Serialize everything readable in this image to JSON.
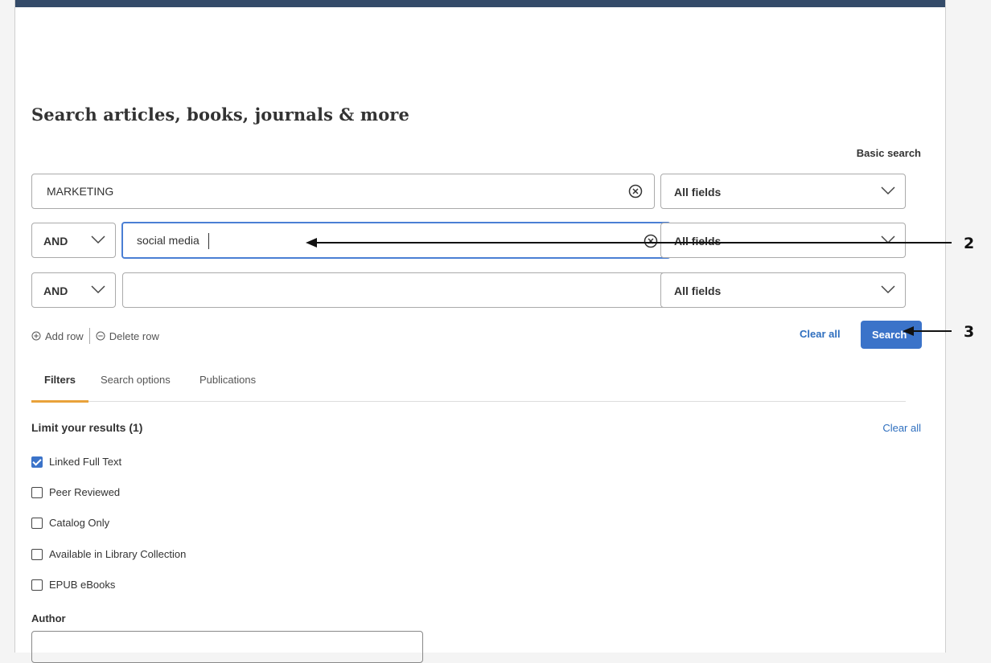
{
  "page": {
    "heading": "Search articles, books, journals & more",
    "basic_search_link": "Basic search"
  },
  "rows": [
    {
      "operator": null,
      "value": "MARKETING",
      "field": "All fields"
    },
    {
      "operator": "AND",
      "value": "social media",
      "field": "All fields"
    },
    {
      "operator": "AND",
      "value": "",
      "field": "All fields"
    }
  ],
  "row_controls": {
    "add_row": "Add row",
    "delete_row": "Delete row",
    "clear_all": "Clear all",
    "search": "Search"
  },
  "tabs": [
    {
      "label": "Filters",
      "active": true
    },
    {
      "label": "Search options",
      "active": false
    },
    {
      "label": "Publications",
      "active": false
    }
  ],
  "filters": {
    "heading": "Limit your results (1)",
    "clear_all": "Clear all",
    "items": [
      {
        "label": "Linked Full Text",
        "checked": true
      },
      {
        "label": "Peer Reviewed",
        "checked": false
      },
      {
        "label": "Catalog Only",
        "checked": false
      },
      {
        "label": "Available in Library Collection",
        "checked": false
      },
      {
        "label": "EPUB eBooks",
        "checked": false
      }
    ],
    "author_label": "Author",
    "author_value": ""
  },
  "annotations": {
    "arrow_2_label": "2",
    "arrow_3_label": "3"
  },
  "colors": {
    "accent": "#3b73c9",
    "top_bar": "#344b69",
    "tab_underline": "#e9a23b",
    "link": "#2f6fbf"
  }
}
